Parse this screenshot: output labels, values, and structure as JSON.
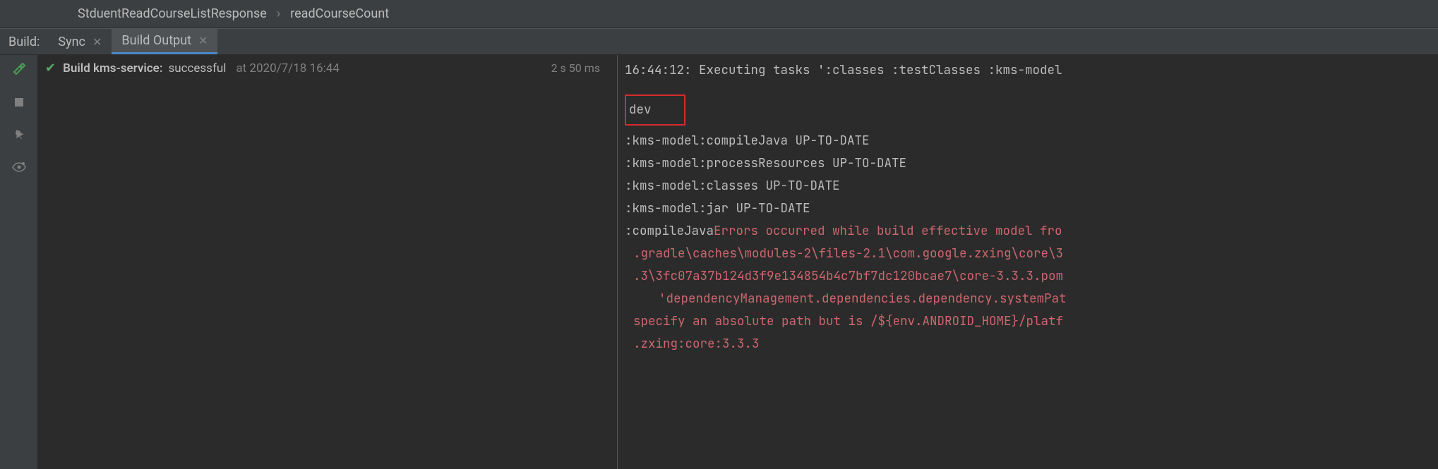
{
  "breadcrumb": {
    "item1": "StduentReadCourseListResponse",
    "item2": "readCourseCount"
  },
  "tabs": {
    "label": "Build:",
    "tab1": "Sync",
    "tab2": "Build Output"
  },
  "build": {
    "title": "Build kms-service:",
    "status": "successful",
    "timestamp": "at 2020/7/18 16:44",
    "duration": "2 s 50 ms"
  },
  "console": {
    "line1": "16:44:12: Executing tasks ':classes :testClasses :kms-model",
    "dev": "dev",
    "line2": ":kms-model:compileJava UP-TO-DATE",
    "line3": ":kms-model:processResources UP-TO-DATE",
    "line4": ":kms-model:classes UP-TO-DATE",
    "line5": ":kms-model:jar UP-TO-DATE",
    "line6a": ":compileJava",
    "line6b": "Errors occurred while build effective model fro",
    "line7": ".gradle\\caches\\modules-2\\files-2.1\\com.google.zxing\\core\\3",
    "line8": ".3\\3fc07a37b124d3f9e134854b4c7bf7dc120bcae7\\core-3.3.3.pom",
    "line9": "'dependencyManagement.dependencies.dependency.systemPat",
    "line10": "specify an absolute path but is /${env.ANDROID_HOME}/platf",
    "line11": ".zxing:core:3.3.3"
  }
}
